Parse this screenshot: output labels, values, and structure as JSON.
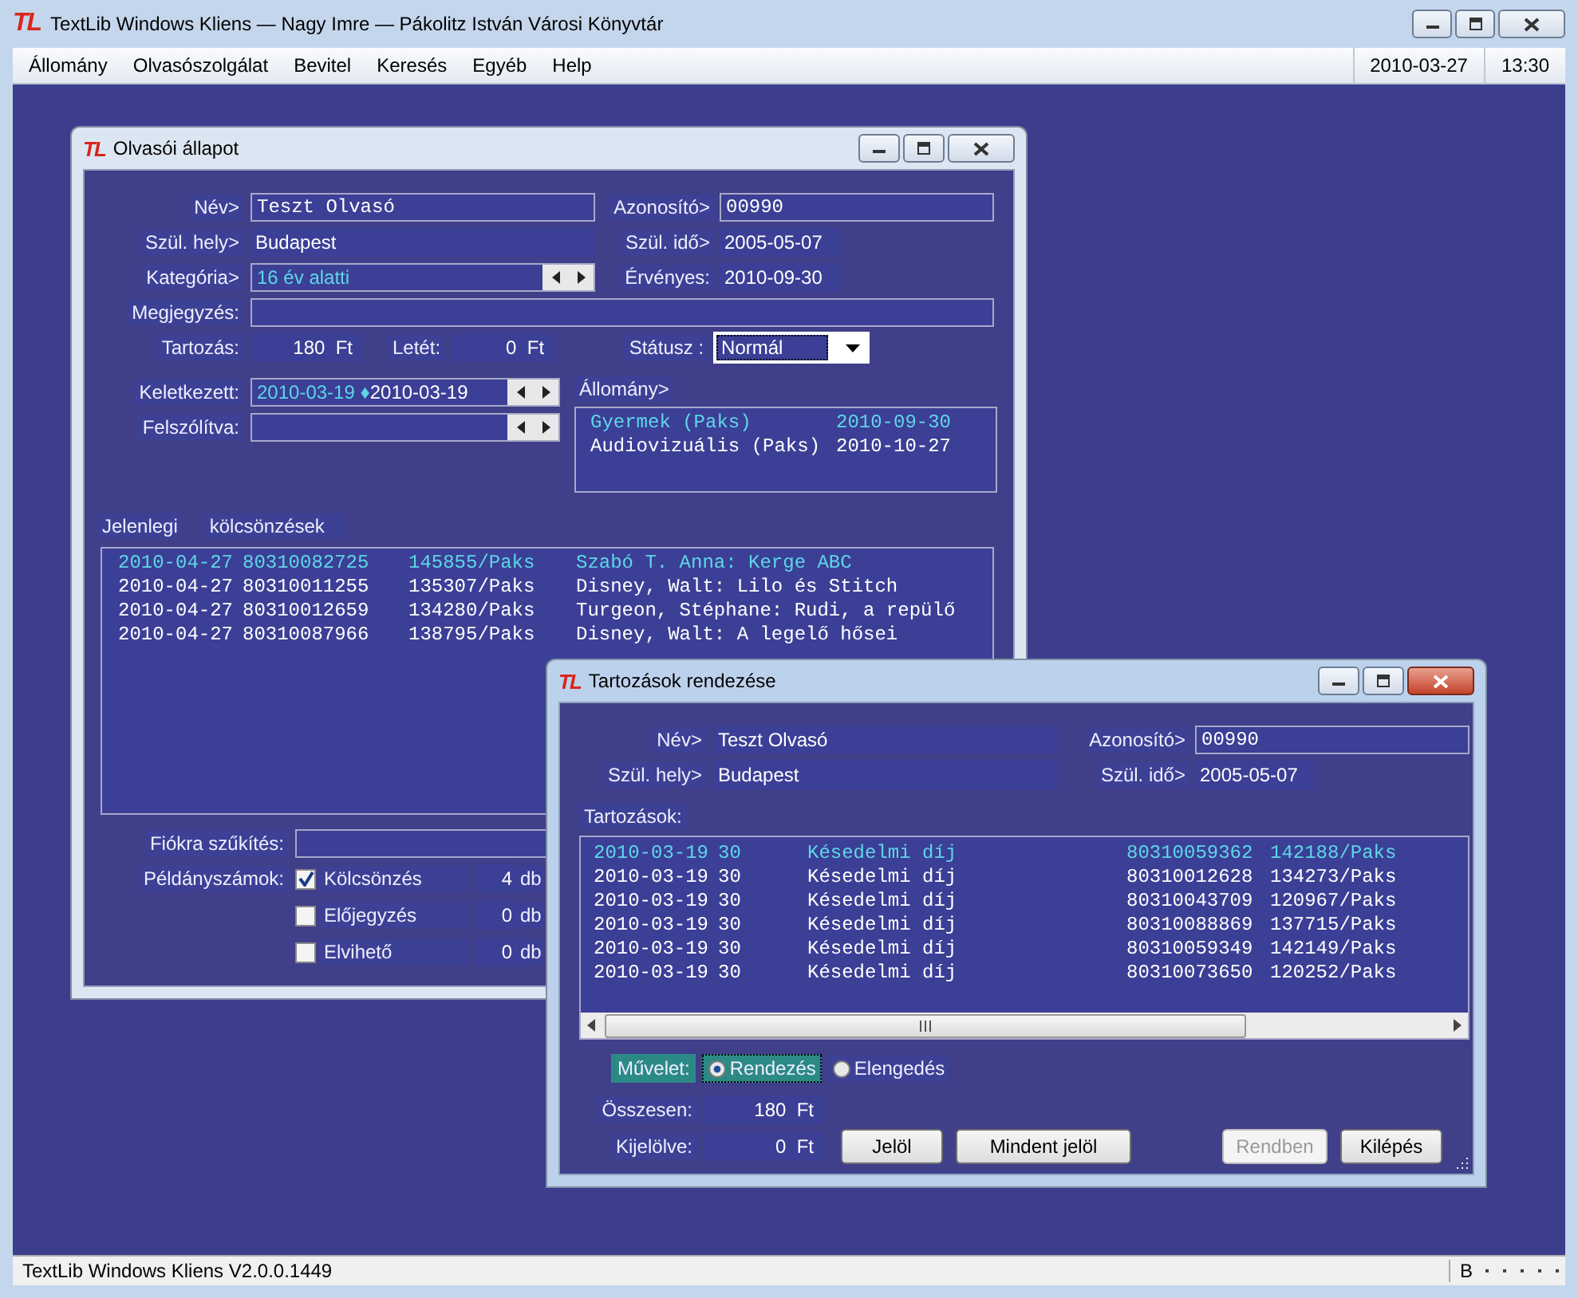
{
  "app": {
    "logo": "TL",
    "title": "TextLib Windows Kliens — Nagy Imre — Pákolitz István Városi Könyvtár"
  },
  "menu": [
    "Állomány",
    "Olvasószolgálat",
    "Bevitel",
    "Keresés",
    "Egyéb",
    "Help"
  ],
  "clock": {
    "date": "2010-03-27",
    "time": "13:30"
  },
  "reader_window": {
    "logo": "TL",
    "title": "Olvasói állapot",
    "active": false,
    "name": {
      "label": "Név>",
      "value": "Teszt Olvasó"
    },
    "id": {
      "label": "Azonosító>",
      "value": "00990"
    },
    "birthplace": {
      "label": "Szül. hely>",
      "value": "Budapest"
    },
    "birthdate": {
      "label": "Szül. idő>",
      "value": "2005-05-07"
    },
    "category": {
      "label": "Kategória>",
      "value": "16 év alatti"
    },
    "valid": {
      "label": "Érvényes:",
      "value": "2010-09-30"
    },
    "note": {
      "label": "Megjegyzés:"
    },
    "debt": {
      "label": "Tartozás:",
      "value": "180  Ft"
    },
    "deposit": {
      "label": "Letét:",
      "value": "0  Ft"
    },
    "status": {
      "label": "Státusz :",
      "value": "Normál"
    },
    "created": {
      "label": "Keletkezett:",
      "from": "2010-03-19",
      "separator": "♦",
      "to": "2010-03-19"
    },
    "notified": {
      "label": "Felszólítva:"
    },
    "holdings": {
      "label": "Állomány>",
      "rows": [
        {
          "name": "Gyermek (Paks)",
          "date": "2010-09-30",
          "selected": true
        },
        {
          "name": "Audiovizuális (Paks)",
          "date": "2010-10-27",
          "selected": false
        }
      ]
    },
    "loans": {
      "label": "Jelenlegi",
      "label_2": "kölcsönzések",
      "rows": [
        {
          "date": "2010-04-27",
          "barcode": "80310082725",
          "inventory": "145855/Paks",
          "title": "Szabó T. Anna: Kerge ABC",
          "selected": true
        },
        {
          "date": "2010-04-27",
          "barcode": "80310011255",
          "inventory": "135307/Paks",
          "title": "Disney, Walt: Lilo és Stitch",
          "selected": false
        },
        {
          "date": "2010-04-27",
          "barcode": "80310012659",
          "inventory": "134280/Paks",
          "title": "Turgeon, Stéphane: Rudi, a repülő",
          "selected": false
        },
        {
          "date": "2010-04-27",
          "barcode": "80310087966",
          "inventory": "138795/Paks",
          "title": "Disney, Walt: A legelő hősei",
          "selected": false
        }
      ]
    },
    "branch_filter": {
      "label": "Fiókra szűkítés:"
    },
    "copies": {
      "label": "Példányszámok:",
      "items": [
        {
          "label": "Kölcsönzés",
          "checked": true,
          "count": "4",
          "unit": "db"
        },
        {
          "label": "Előjegyzés",
          "checked": false,
          "count": "0",
          "unit": "db"
        },
        {
          "label": "Elvihető",
          "checked": false,
          "count": "0",
          "unit": "db"
        }
      ]
    }
  },
  "debts_window": {
    "logo": "TL",
    "title": "Tartozások rendezése",
    "active": true,
    "name": {
      "label": "Név>",
      "value": "Teszt Olvasó"
    },
    "id": {
      "label": "Azonosító>",
      "value": "00990"
    },
    "birthplace": {
      "label": "Szül. hely>",
      "value": "Budapest"
    },
    "birthdate": {
      "label": "Szül. idő>",
      "value": "2005-05-07"
    },
    "debts": {
      "label": "Tartozások:",
      "rows": [
        {
          "date": "2010-03-19",
          "days": "30",
          "type": "Késedelmi díj",
          "barcode": "80310059362",
          "inventory": "142188/Paks",
          "selected": true
        },
        {
          "date": "2010-03-19",
          "days": "30",
          "type": "Késedelmi díj",
          "barcode": "80310012628",
          "inventory": "134273/Paks",
          "selected": false
        },
        {
          "date": "2010-03-19",
          "days": "30",
          "type": "Késedelmi díj",
          "barcode": "80310043709",
          "inventory": "120967/Paks",
          "selected": false
        },
        {
          "date": "2010-03-19",
          "days": "30",
          "type": "Késedelmi díj",
          "barcode": "80310088869",
          "inventory": "137715/Paks",
          "selected": false
        },
        {
          "date": "2010-03-19",
          "days": "30",
          "type": "Késedelmi díj",
          "barcode": "80310059349",
          "inventory": "142149/Paks",
          "selected": false
        },
        {
          "date": "2010-03-19",
          "days": "30",
          "type": "Késedelmi díj",
          "barcode": "80310073650",
          "inventory": "120252/Paks",
          "selected": false
        }
      ]
    },
    "operation": {
      "label": "Művelet:",
      "options": [
        {
          "label": "Rendezés",
          "selected": true
        },
        {
          "label": "Elengedés",
          "selected": false
        }
      ]
    },
    "total": {
      "label": "Összesen:",
      "value": "180  Ft"
    },
    "marked": {
      "label": "Kijelölve:",
      "value": "0  Ft"
    },
    "buttons": [
      {
        "label": "Jelöl",
        "disabled": false
      },
      {
        "label": "Mindent jelöl",
        "disabled": false
      },
      {
        "label": "Rendben",
        "disabled": true
      },
      {
        "label": "Kilépés",
        "disabled": false
      }
    ]
  },
  "status_bar": {
    "text": "TextLib Windows Kliens V2.0.0.1449",
    "indicator": "B"
  }
}
